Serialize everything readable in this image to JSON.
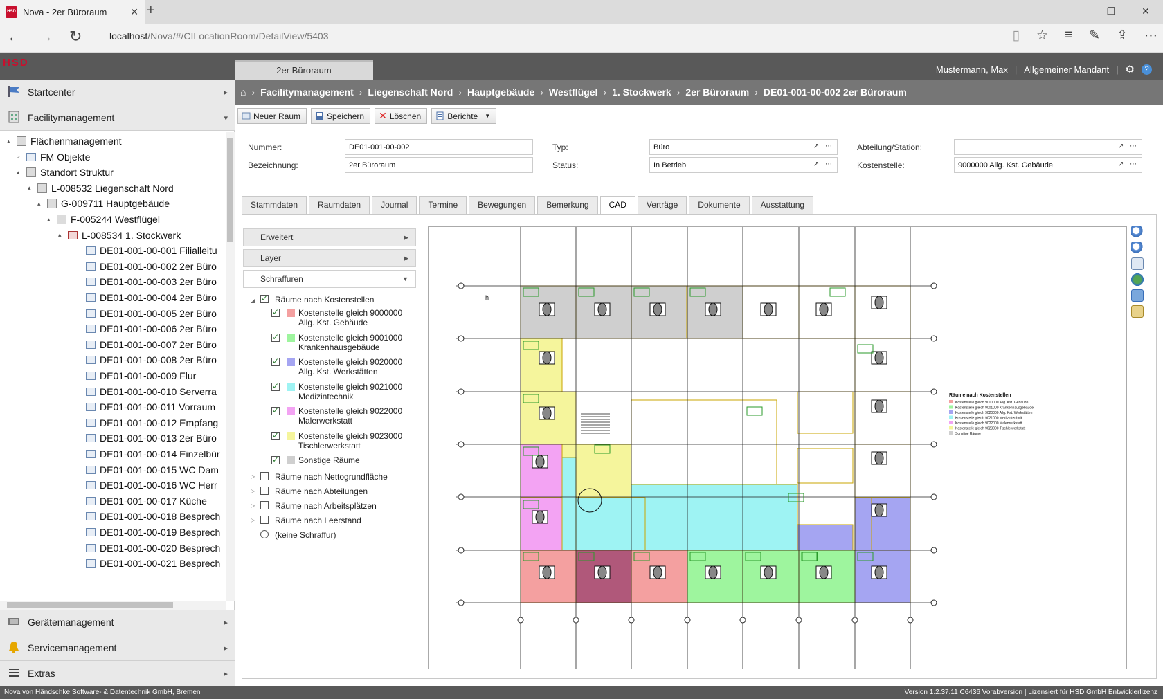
{
  "browser": {
    "tab_title": "Nova - 2er Büroraum",
    "favicon_text": "HSD",
    "url_host": "localhost",
    "url_path": "/Nova/#/CILocationRoom/DetailView/5403"
  },
  "app": {
    "logo": "HSD",
    "open_tab": "2er Büroraum",
    "user": "Mustermann, Max",
    "tenant": "Allgemeiner Mandant",
    "help": "?"
  },
  "breadcrumb": [
    "Facilitymanagement",
    "Liegenschaft Nord",
    "Hauptgebäude",
    "Westflügel",
    "1. Stockwerk",
    "2er Büroraum",
    "DE01-001-00-002 2er Büroraum"
  ],
  "sidebar": {
    "top": [
      {
        "label": "Startcenter"
      },
      {
        "label": "Facilitymanagement"
      }
    ],
    "bottom": [
      {
        "label": "Gerätemanagement"
      },
      {
        "label": "Servicemanagement"
      },
      {
        "label": "Extras"
      }
    ],
    "tree": [
      {
        "label": "Flächenmanagement"
      },
      {
        "label": "FM Objekte"
      },
      {
        "label": "Standort Struktur"
      },
      {
        "label": "L-008532 Liegenschaft Nord"
      },
      {
        "label": "G-009711 Hauptgebäude"
      },
      {
        "label": "F-005244 Westflügel"
      },
      {
        "label": "L-008534 1. Stockwerk"
      },
      {
        "label": "DE01-001-00-001 Filialleitu"
      },
      {
        "label": "DE01-001-00-002 2er Büro"
      },
      {
        "label": "DE01-001-00-003 2er Büro"
      },
      {
        "label": "DE01-001-00-004 2er Büro"
      },
      {
        "label": "DE01-001-00-005 2er Büro"
      },
      {
        "label": "DE01-001-00-006 2er Büro"
      },
      {
        "label": "DE01-001-00-007 2er Büro"
      },
      {
        "label": "DE01-001-00-008 2er Büro"
      },
      {
        "label": "DE01-001-00-009 Flur"
      },
      {
        "label": "DE01-001-00-010 Serverra"
      },
      {
        "label": "DE01-001-00-011 Vorraum"
      },
      {
        "label": "DE01-001-00-012 Empfang"
      },
      {
        "label": "DE01-001-00-013 2er Büro"
      },
      {
        "label": "DE01-001-00-014 Einzelbür"
      },
      {
        "label": "DE01-001-00-015 WC Dam"
      },
      {
        "label": "DE01-001-00-016 WC Herr"
      },
      {
        "label": "DE01-001-00-017 Küche"
      },
      {
        "label": "DE01-001-00-018 Besprech"
      },
      {
        "label": "DE01-001-00-019 Besprech"
      },
      {
        "label": "DE01-001-00-020 Besprech"
      },
      {
        "label": "DE01-001-00-021 Besprech"
      }
    ]
  },
  "toolbar": {
    "new": "Neuer Raum",
    "save": "Speichern",
    "delete": "Löschen",
    "reports": "Berichte"
  },
  "form": {
    "nummer_label": "Nummer:",
    "nummer": "DE01-001-00-002",
    "bezeichnung_label": "Bezeichnung:",
    "bezeichnung": "2er Büroraum",
    "typ_label": "Typ:",
    "typ": "Büro",
    "status_label": "Status:",
    "status": "In Betrieb",
    "abteilung_label": "Abteilung/Station:",
    "abteilung": "",
    "kostenstelle_label": "Kostenstelle:",
    "kostenstelle": "9000000 Allg. Kst. Gebäude"
  },
  "tabs": [
    "Stammdaten",
    "Raumdaten",
    "Journal",
    "Termine",
    "Bewegungen",
    "Bemerkung",
    "CAD",
    "Verträge",
    "Dokumente",
    "Ausstattung"
  ],
  "filter": {
    "erweitert": "Erweitert",
    "layer": "Layer",
    "schraffuren": "Schraffuren",
    "group": "Räume nach Kostenstellen",
    "items": [
      {
        "label": "Kostenstelle gleich 9000000 Allg. Kst. Gebäude",
        "color": "#f4a0a0"
      },
      {
        "label": "Kostenstelle gleich 9001000 Krankenhausgebäude",
        "color": "#9ef59e"
      },
      {
        "label": "Kostenstelle gleich 9020000 Allg. Kst. Werkstätten",
        "color": "#a5a5f2"
      },
      {
        "label": "Kostenstelle gleich 9021000 Medizintechnik",
        "color": "#9ef3f3"
      },
      {
        "label": "Kostenstelle gleich 9022000 Malerwerkstatt",
        "color": "#f3a3f3"
      },
      {
        "label": "Kostenstelle gleich 9023000 Tischlerwerkstatt",
        "color": "#f5f59c"
      },
      {
        "label": "Sonstige Räume",
        "color": "#cfcfcf"
      }
    ],
    "others": [
      "Räume nach Nettogrundfläche",
      "Räume nach Abteilungen",
      "Räume nach Arbeitsplätzen",
      "Räume nach Leerstand"
    ],
    "none": "(keine Schraffur)"
  },
  "cad_legend": {
    "title": "Räume nach Kostenstellen",
    "items": [
      {
        "label": "Kostenstelle gleich 9000000 Allg. Kst. Gebäude",
        "color": "#f4a0a0"
      },
      {
        "label": "Kostenstelle gleich 9001000 Krankenhausgebäude",
        "color": "#9ef59e"
      },
      {
        "label": "Kostenstelle gleich 9020000 Allg. Kst. Werkstätten",
        "color": "#a5a5f2"
      },
      {
        "label": "Kostenstelle gleich 9021000 Medizintechnik",
        "color": "#9ef3f3"
      },
      {
        "label": "Kostenstelle gleich 9022000 Malerwerkstatt",
        "color": "#f3a3f3"
      },
      {
        "label": "Kostenstelle gleich 9023000 Tischlerwerkstatt",
        "color": "#f5f59c"
      },
      {
        "label": "Sonstige Räume",
        "color": "#cfcfcf"
      }
    ]
  },
  "cad_markers": [
    "1",
    "2",
    "3",
    "4",
    "5",
    "6",
    "7",
    "8",
    "G",
    "F",
    "E",
    "D",
    "C",
    "B",
    "A"
  ],
  "cad_text": "h",
  "status": {
    "left": "Nova von Händschke Software- & Datentechnik GmbH, Bremen",
    "right": "Version 1.2.37.11 C6436 Vorabversion | Lizensiert für HSD GmbH Entwicklerlizenz"
  }
}
